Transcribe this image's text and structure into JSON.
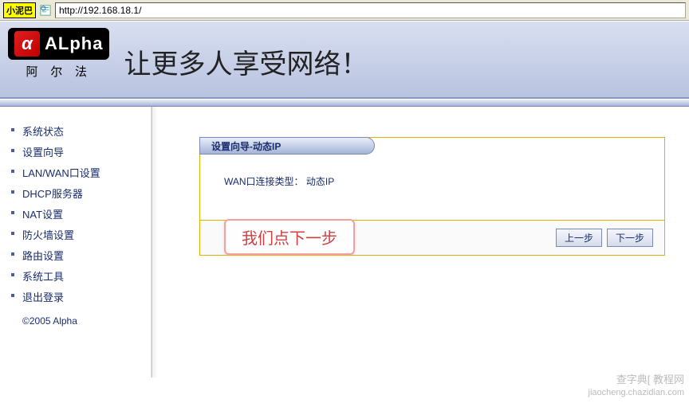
{
  "browser": {
    "badge": "小泥巴",
    "url": "http://192.168.18.1/"
  },
  "header": {
    "logo_mark": "α",
    "logo_text": "ALpha",
    "logo_cn": "阿 尔 法",
    "slogan": "让更多人享受网络！"
  },
  "sidebar": {
    "items": [
      {
        "label": "系统状态"
      },
      {
        "label": "设置向导"
      },
      {
        "label": "LAN/WAN口设置"
      },
      {
        "label": "DHCP服务器"
      },
      {
        "label": "NAT设置"
      },
      {
        "label": "防火墙设置"
      },
      {
        "label": "路由设置"
      },
      {
        "label": "系统工具"
      },
      {
        "label": "退出登录"
      }
    ],
    "copyright": "©2005 Alpha"
  },
  "panel": {
    "title": "设置向导-动态IP",
    "body_label": "WAN口连接类型：",
    "body_value": "动态IP",
    "prev_label": "上一步",
    "next_label": "下一步"
  },
  "callout": "我们点下一步",
  "watermark": {
    "line1": "查字典[ 教程网",
    "line2": "jiaocheng.chazidian.com"
  }
}
